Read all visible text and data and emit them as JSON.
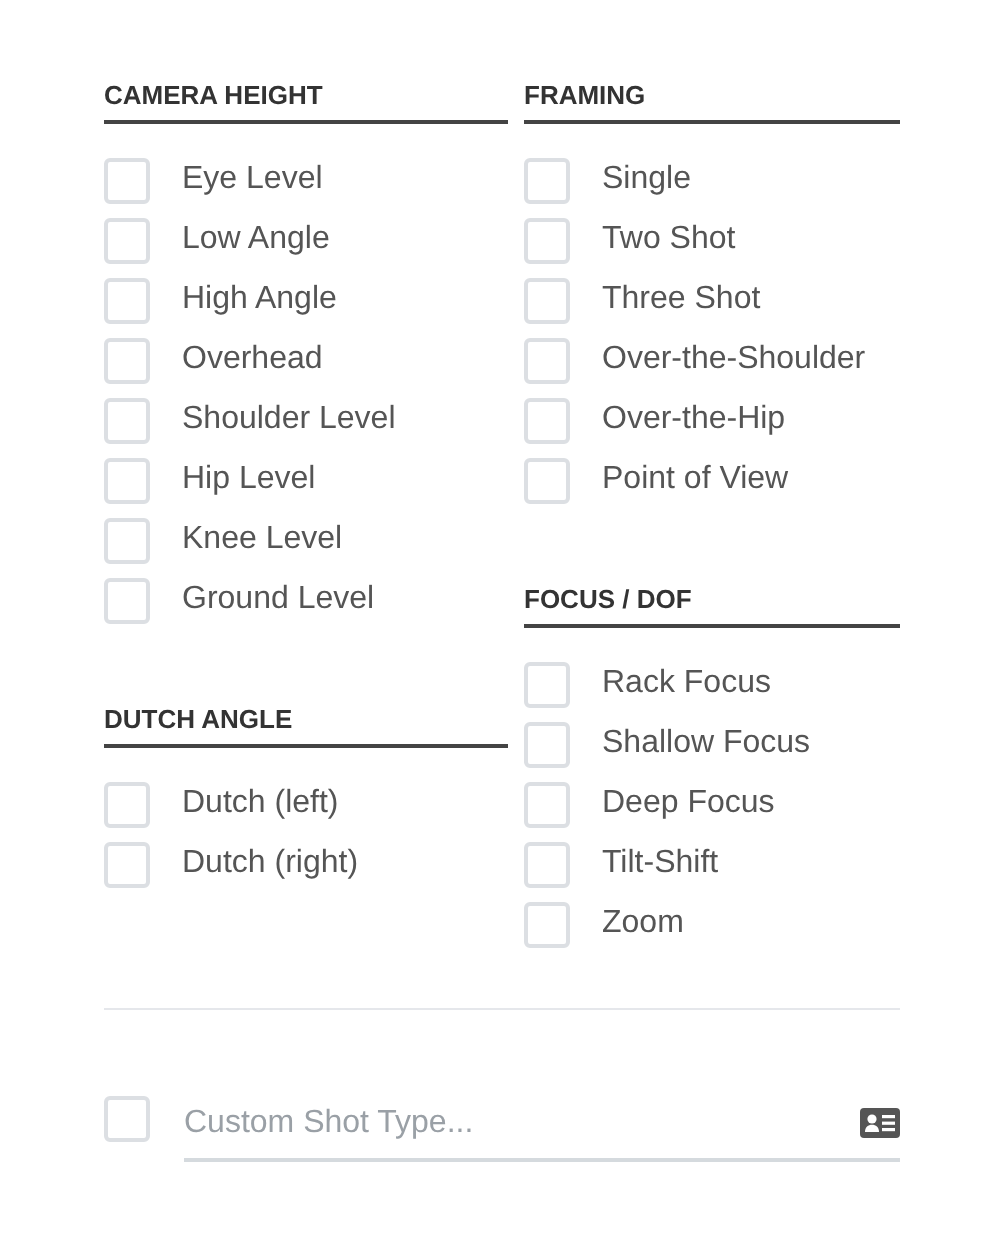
{
  "columns": [
    [
      {
        "heading": "CAMERA HEIGHT",
        "options": [
          {
            "label": "Eye Level",
            "checked": false
          },
          {
            "label": "Low Angle",
            "checked": false
          },
          {
            "label": "High Angle",
            "checked": false
          },
          {
            "label": "Overhead",
            "checked": false
          },
          {
            "label": "Shoulder Level",
            "checked": false
          },
          {
            "label": "Hip Level",
            "checked": false
          },
          {
            "label": "Knee Level",
            "checked": false
          },
          {
            "label": "Ground Level",
            "checked": false
          }
        ]
      },
      {
        "heading": "DUTCH ANGLE",
        "options": [
          {
            "label": "Dutch (left)",
            "checked": false
          },
          {
            "label": "Dutch (right)",
            "checked": false
          }
        ]
      }
    ],
    [
      {
        "heading": "FRAMING",
        "options": [
          {
            "label": "Single",
            "checked": false
          },
          {
            "label": "Two Shot",
            "checked": false
          },
          {
            "label": "Three Shot",
            "checked": false
          },
          {
            "label": "Over-the-Shoulder",
            "checked": false
          },
          {
            "label": "Over-the-Hip",
            "checked": false
          },
          {
            "label": "Point of View",
            "checked": false
          }
        ]
      },
      {
        "heading": "FOCUS / DOF",
        "options": [
          {
            "label": "Rack Focus",
            "checked": false
          },
          {
            "label": "Shallow Focus",
            "checked": false
          },
          {
            "label": "Deep Focus",
            "checked": false
          },
          {
            "label": "Tilt-Shift",
            "checked": false
          },
          {
            "label": "Zoom",
            "checked": false
          }
        ]
      }
    ]
  ],
  "custom": {
    "checked": false,
    "placeholder": "Custom Shot Type..."
  }
}
